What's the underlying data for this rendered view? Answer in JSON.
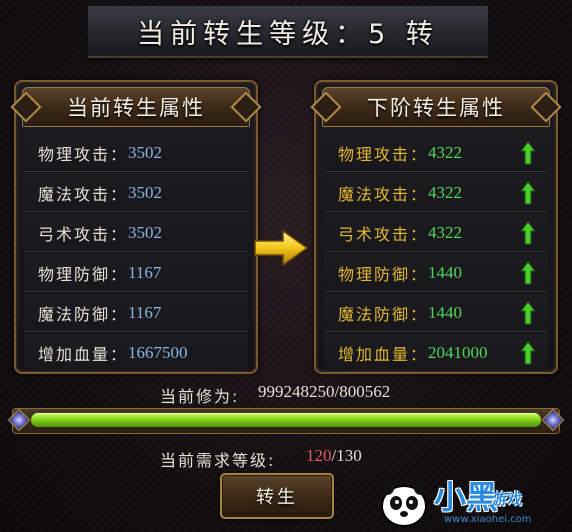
{
  "title": "当前转生等级：5 转",
  "current_panel": {
    "title": "当前转生属性",
    "rows": [
      {
        "label": "物理攻击：",
        "value": "3502"
      },
      {
        "label": "魔法攻击：",
        "value": "3502"
      },
      {
        "label": "弓术攻击：",
        "value": "3502"
      },
      {
        "label": "物理防御：",
        "value": "1167"
      },
      {
        "label": "魔法防御：",
        "value": "1167"
      },
      {
        "label": "增加血量：",
        "value": "1667500"
      }
    ]
  },
  "next_panel": {
    "title": "下阶转生属性",
    "rows": [
      {
        "label": "物理攻击：",
        "value": "4322"
      },
      {
        "label": "魔法攻击：",
        "value": "4322"
      },
      {
        "label": "弓术攻击：",
        "value": "4322"
      },
      {
        "label": "物理防御：",
        "value": "1440"
      },
      {
        "label": "魔法防御：",
        "value": "1440"
      },
      {
        "label": "增加血量：",
        "value": "2041000"
      }
    ]
  },
  "progress": {
    "label": "当前修为:",
    "value": "999248250/800562",
    "fill_fraction": 1.0
  },
  "requirement": {
    "label": "当前需求等级:",
    "current": "120",
    "separator": "/",
    "required": "130"
  },
  "rebirth_button": {
    "label": "转生"
  },
  "watermark": {
    "brand": "小黑",
    "sub": "游戏",
    "url": "www.xiaohei.com"
  },
  "colors": {
    "current_value": "#8ab6e6",
    "next_value": "#4fd65a",
    "next_label": "#e2b62e",
    "requirement_current": "#e85a6a",
    "progress_fill": "#8fd61e"
  },
  "icons": {
    "transition_arrow": "right-arrow-icon",
    "increase_marker": "green-up-arrow-icon"
  }
}
